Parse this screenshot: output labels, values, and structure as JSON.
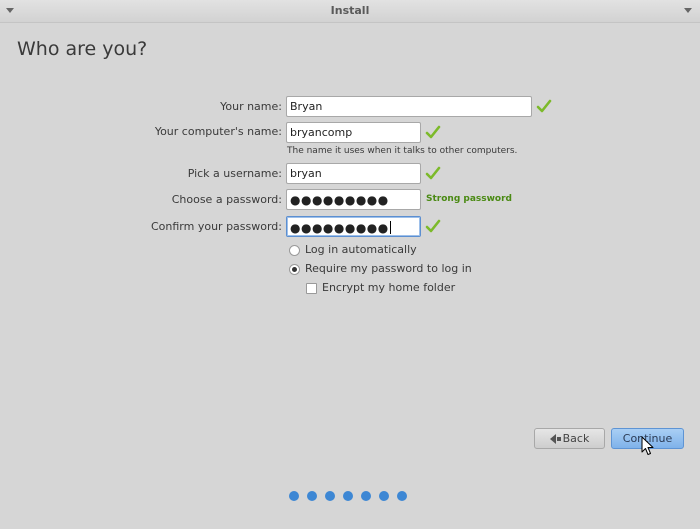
{
  "window": {
    "title": "Install"
  },
  "page": {
    "title": "Who are you?"
  },
  "form": {
    "name": {
      "label": "Your name:",
      "value": "Bryan",
      "valid": true
    },
    "computer_name": {
      "label": "Your computer's name:",
      "value": "bryancomp",
      "valid": true,
      "hint": "The name it uses when it talks to other computers."
    },
    "username": {
      "label": "Pick a username:",
      "value": "bryan",
      "valid": true
    },
    "password": {
      "label": "Choose a password:",
      "masked_value": "●●●●●●●●●",
      "strength": "Strong password"
    },
    "confirm_password": {
      "label": "Confirm your password:",
      "masked_value": "●●●●●●●●●",
      "valid": true
    }
  },
  "login_options": {
    "auto_login": {
      "label": "Log in automatically",
      "selected": false
    },
    "require_password": {
      "label": "Require my password to log in",
      "selected": true
    },
    "encrypt_home": {
      "label": "Encrypt my home folder",
      "checked": false
    }
  },
  "buttons": {
    "back_label": "Back",
    "continue_label": "Continue"
  },
  "progress": {
    "total_steps": 7
  },
  "colors": {
    "accent": "#3d87d4",
    "valid_check": "#7cba2a",
    "strength_text": "#4a8a13"
  }
}
